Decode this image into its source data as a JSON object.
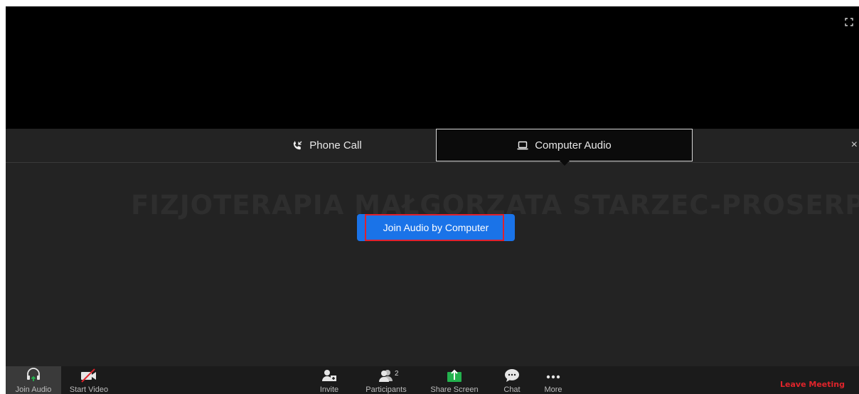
{
  "tabs": {
    "phone_call": "Phone Call",
    "computer_audio": "Computer Audio",
    "selected": "Computer Audio"
  },
  "close_label": "×",
  "meeting_name": "FIZJOTERAPIA MAŁGORZATA STARZEC-PROSERP",
  "join_button_label": "Join Audio by Computer",
  "toolbar": {
    "join_audio": "Join Audio",
    "start_video": "Start Video",
    "invite": "Invite",
    "participants": "Participants",
    "participants_count": "2",
    "share_screen": "Share Screen",
    "chat": "Chat",
    "more": "More",
    "leave_meeting": "Leave Meeting"
  },
  "colors": {
    "primary_button": "#1a73e8",
    "highlight": "#e0212e",
    "leave": "#e0242b",
    "share_green": "#23b14d"
  },
  "icons": [
    "fullscreen-icon",
    "phone-icon",
    "computer-icon",
    "headphones-icon",
    "video-off-icon",
    "invite-icon",
    "participants-icon",
    "share-screen-icon",
    "chat-icon",
    "more-icon"
  ]
}
